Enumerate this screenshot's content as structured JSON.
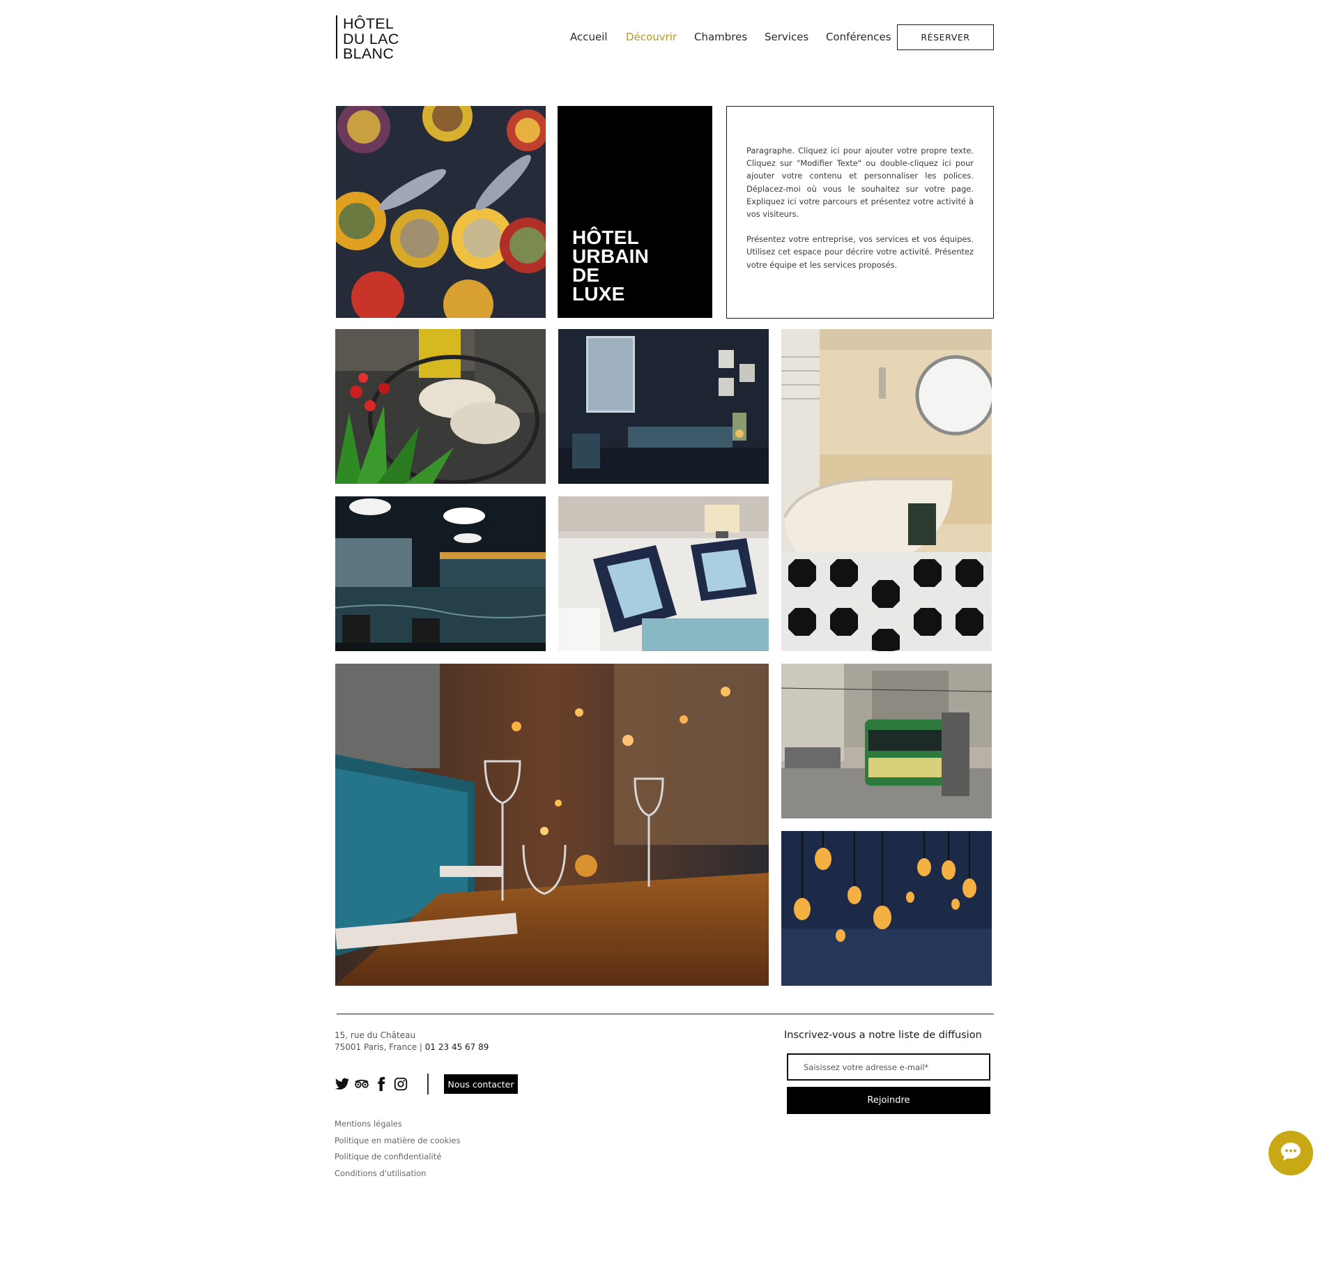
{
  "header": {
    "logo_lines": [
      "HÔTEL",
      "DU LAC",
      "BLANC"
    ],
    "nav": [
      {
        "label": "Accueil",
        "active": false
      },
      {
        "label": "Découvrir",
        "active": true
      },
      {
        "label": "Chambres",
        "active": false
      },
      {
        "label": "Services",
        "active": false
      },
      {
        "label": "Conférences",
        "active": false
      }
    ],
    "reserve_label": "RÉSERVER"
  },
  "hero": {
    "title_lines": [
      "HÔTEL",
      "URBAIN",
      "DE",
      "LUXE"
    ],
    "paragraph_1": "Paragraphe. Cliquez ici pour ajouter votre propre texte. Cliquez sur \"Modifier Texte\" ou double-cliquez ici pour ajouter votre contenu et personnaliser les polices. Déplacez-moi où vous le souhaitez sur votre page. Expliquez ici votre parcours et présentez votre activité à vos visiteurs.",
    "paragraph_2": "Présentez votre entreprise, vos services et vos équipes. Utilisez cet espace pour décrire votre activité. Présentez votre équipe et les services proposés."
  },
  "footer": {
    "address_line_1": "15, rue du Château",
    "address_line_2": "75001 Paris, France |",
    "phone": "01 23 45 67 89",
    "contact_label": "Nous contacter",
    "legal_links": [
      "Mentions légales",
      "Politique en matière de cookies",
      "Politique de confidentialité",
      "Conditions d'utilisation"
    ],
    "newsletter_title": "Inscrivez-vous a notre liste de diffusion",
    "email_placeholder": "Saisissez votre adresse e-mail*",
    "join_label": "Rejoindre"
  },
  "colors": {
    "accent": "#b6972a",
    "chat_button": "#c8a915",
    "black": "#000000"
  },
  "icons": [
    "twitter-icon",
    "tripadvisor-icon",
    "facebook-icon",
    "instagram-icon",
    "chat-icon"
  ]
}
